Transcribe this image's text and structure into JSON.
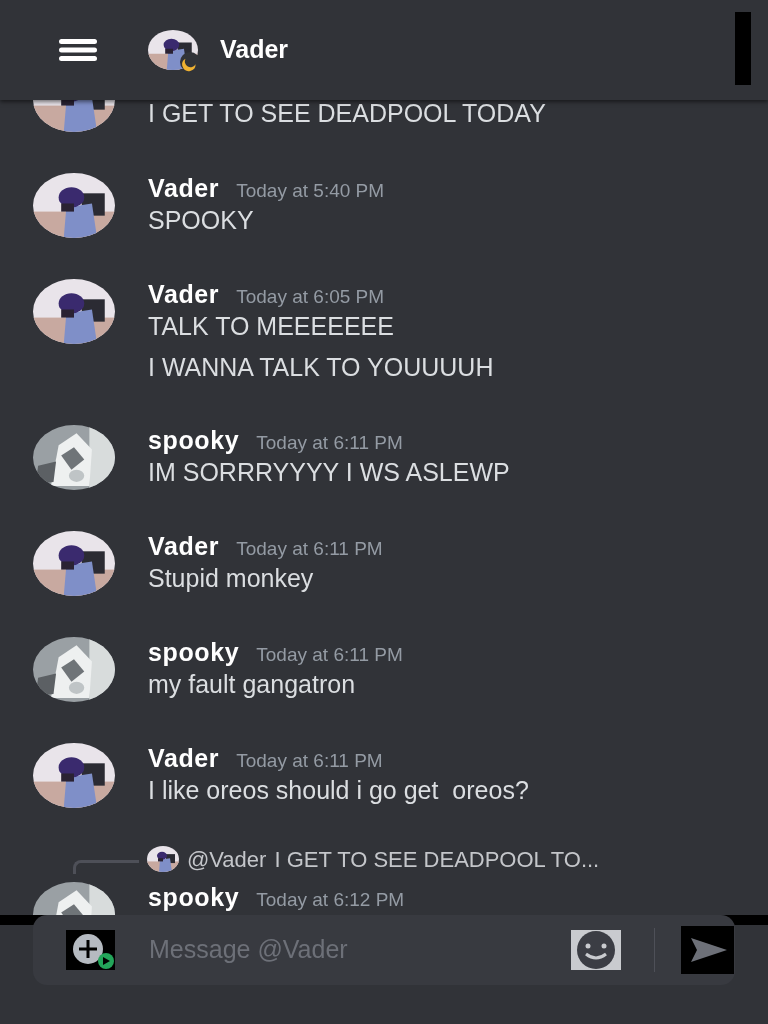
{
  "header": {
    "title": "Vader",
    "idle": true
  },
  "messages": [
    {
      "kind": "a",
      "lines": [
        "I GET TO SEE DEADPOOL TODAY"
      ]
    },
    {
      "kind": "a",
      "author": "Vader",
      "time": "Today at 5:40 PM",
      "lines": [
        "SPOOKY"
      ]
    },
    {
      "kind": "a",
      "author": "Vader",
      "time": "Today at 6:05 PM",
      "lines": [
        "TALK TO MEEEEEEE",
        "I WANNA TALK TO YOUUUUH"
      ]
    },
    {
      "kind": "b",
      "author": "spooky",
      "time": "Today at 6:11 PM",
      "lines": [
        "IM SORRRYYYY I WS ASLEWP"
      ]
    },
    {
      "kind": "a",
      "author": "Vader",
      "time": "Today at 6:11 PM",
      "lines": [
        "Stupid monkey"
      ]
    },
    {
      "kind": "b",
      "author": "spooky",
      "time": "Today at 6:11 PM",
      "lines": [
        "my fault gangatron"
      ]
    },
    {
      "kind": "a",
      "author": "Vader",
      "time": "Today at 6:11 PM",
      "lines": [
        "I like oreos should i go get  oreos?"
      ]
    },
    {
      "kind": "b",
      "author": "spooky",
      "time": "Today at 6:12 PM",
      "reply": {
        "kind": "a",
        "author": "@Vader",
        "text": "I GET TO SEE DEADPOOL TO..."
      }
    }
  ],
  "composer": {
    "placeholder": "Message @Vader"
  }
}
